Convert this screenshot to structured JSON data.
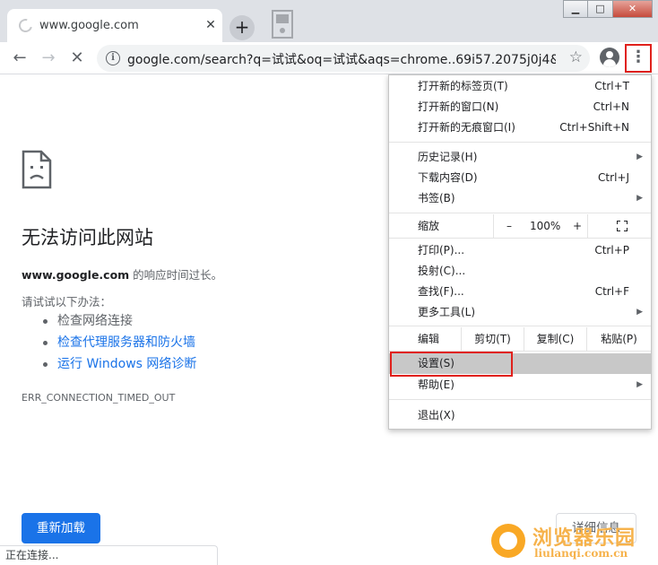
{
  "browser": {
    "tab_title": "www.google.com",
    "tab_close": "✕",
    "new_tab": "+",
    "window_controls": {
      "minimize": "▁",
      "maximize": "□",
      "close": "✕"
    }
  },
  "toolbar": {
    "back": "←",
    "forward": "→",
    "stop": "✕",
    "url": "google.com/search?q=试试&oq=试试&aqs=chrome..69i57.2075j0j4&...",
    "info": "i",
    "bookmark_star": "☆",
    "menu": "⋮"
  },
  "error_page": {
    "title": "无法访问此网站",
    "desc_host": "www.google.com",
    "desc_tail": " 的响应时间过长。",
    "try_label": "请试试以下办法：",
    "suggestions": [
      "检查网络连接",
      "检查代理服务器和防火墙",
      "运行 Windows 网络诊断"
    ],
    "error_code": "ERR_CONNECTION_TIMED_OUT",
    "reload_button": "重新加载",
    "details_button": "详细信息"
  },
  "status_bar": "正在连接...",
  "watermark": {
    "text": "浏览器乐园",
    "url": "liulanqi.com.cn"
  },
  "menu": {
    "items": [
      {
        "label": "打开新的标签页(T)",
        "shortcut": "Ctrl+T"
      },
      {
        "label": "打开新的窗口(N)",
        "shortcut": "Ctrl+N"
      },
      {
        "label": "打开新的无痕窗口(I)",
        "shortcut": "Ctrl+Shift+N"
      },
      {
        "label": "历史记录(H)",
        "shortcut": ""
      },
      {
        "label": "下载内容(D)",
        "shortcut": "Ctrl+J"
      },
      {
        "label": "书签(B)",
        "shortcut": ""
      },
      {
        "label": "打印(P)...",
        "shortcut": "Ctrl+P"
      },
      {
        "label": "投射(C)...",
        "shortcut": ""
      },
      {
        "label": "查找(F)...",
        "shortcut": "Ctrl+F"
      },
      {
        "label": "更多工具(L)",
        "shortcut": ""
      },
      {
        "label": "设置(S)",
        "shortcut": ""
      },
      {
        "label": "帮助(E)",
        "shortcut": ""
      },
      {
        "label": "退出(X)",
        "shortcut": ""
      }
    ],
    "zoom": {
      "label": "缩放",
      "minus": "–",
      "value": "100%",
      "plus": "+"
    },
    "edit": {
      "label": "编辑",
      "cut": "剪切(T)",
      "copy": "复制(C)",
      "paste": "粘贴(P)"
    },
    "submenu_arrow": "▶"
  },
  "colors": {
    "accent": "#1a73e8",
    "highlight_red": "#e0211c",
    "menu_hover": "#c8c8c8"
  }
}
